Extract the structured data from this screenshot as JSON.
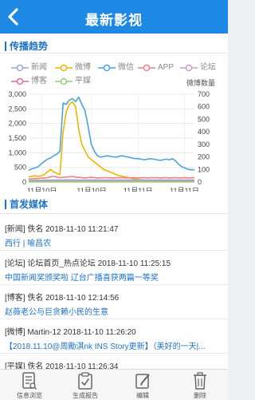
{
  "header": {
    "title": "最新影视"
  },
  "trend": {
    "title": "传播趋势",
    "legend": [
      {
        "label": "新闻",
        "color": "#9aa6d6"
      },
      {
        "label": "微博",
        "color": "#f0b400"
      },
      {
        "label": "微信",
        "color": "#4aa3df"
      },
      {
        "label": "APP",
        "color": "#f08080"
      },
      {
        "label": "论坛",
        "color": "#c8a0c8"
      },
      {
        "label": "博客",
        "color": "#e06d9a"
      },
      {
        "label": "平媒",
        "color": "#8fd16f"
      }
    ],
    "right_axis_label": "微博数量"
  },
  "chart_data": {
    "type": "line",
    "x_tick_labels": [
      "11月10日",
      "11月10日",
      "11月11日",
      "11月11日"
    ],
    "left_axis": {
      "range": [
        0,
        3000
      ],
      "ticks": [
        "0",
        "500",
        "1,000",
        "1,500",
        "2,000",
        "2,500",
        "3,000"
      ]
    },
    "right_axis": {
      "label": "微博数量",
      "range": [
        0,
        700
      ],
      "ticks": [
        "0",
        "100",
        "200",
        "300",
        "400",
        "500",
        "600",
        "700"
      ]
    },
    "series": [
      {
        "name": "微信",
        "axis": "left",
        "color": "#4aa3df",
        "values": [
          400,
          450,
          480,
          520,
          620,
          700,
          780,
          820,
          900,
          950,
          1050,
          2700,
          2650,
          2800,
          2850,
          2750,
          2900,
          2650,
          2450,
          1900,
          1300,
          1050,
          900,
          850,
          870,
          900,
          880,
          860,
          850,
          880,
          900,
          870,
          850,
          820,
          800,
          800,
          780,
          760,
          780,
          800,
          780,
          760,
          740,
          760,
          780,
          760,
          800,
          720,
          600,
          520,
          480,
          430,
          420,
          420
        ]
      },
      {
        "name": "微博",
        "axis": "right",
        "color": "#f0b400",
        "values": [
          40,
          45,
          50,
          45,
          50,
          60,
          80,
          100,
          80,
          70,
          60,
          400,
          560,
          620,
          640,
          600,
          420,
          300,
          250,
          200,
          180,
          160,
          140,
          120,
          100,
          90,
          80,
          70,
          60,
          50,
          45,
          40,
          35,
          30,
          25,
          20,
          18,
          15,
          15,
          14,
          13,
          12,
          12,
          12,
          12,
          12,
          12,
          12,
          12,
          12,
          12,
          12,
          12,
          12
        ]
      },
      {
        "name": "APP",
        "axis": "left",
        "color": "#f08080",
        "values": [
          100,
          110,
          120,
          120,
          130,
          140,
          150,
          180,
          190,
          170,
          150,
          160,
          170,
          180,
          190,
          170,
          160,
          150,
          140,
          150,
          160,
          150,
          140,
          145,
          150,
          150,
          145,
          140,
          150,
          145,
          150,
          140,
          150,
          145,
          150,
          140,
          145,
          150,
          140,
          150,
          145,
          150,
          140,
          145,
          150,
          140,
          145,
          150,
          140,
          145,
          150,
          140,
          145,
          150
        ]
      },
      {
        "name": "新闻",
        "axis": "left",
        "color": "#9aa6d6",
        "values": [
          50,
          55,
          60,
          60,
          60,
          65,
          65,
          70,
          70,
          70,
          70,
          70,
          75,
          75,
          75,
          70,
          70,
          70,
          70,
          70,
          70,
          70,
          70,
          70,
          70,
          70,
          70,
          70,
          70,
          70,
          70,
          70,
          70,
          70,
          70,
          70,
          70,
          70,
          70,
          70,
          70,
          70,
          70,
          70,
          70,
          70,
          70,
          70,
          70,
          70,
          70,
          70,
          70,
          70
        ]
      },
      {
        "name": "论坛",
        "axis": "left",
        "color": "#c8a0c8",
        "values": [
          20,
          22,
          25,
          25,
          25,
          30,
          30,
          30,
          30,
          30,
          30,
          30,
          30,
          30,
          30,
          30,
          30,
          30,
          30,
          30,
          30,
          30,
          30,
          30,
          30,
          30,
          30,
          30,
          30,
          30,
          30,
          30,
          30,
          30,
          30,
          30,
          30,
          30,
          30,
          30,
          30,
          30,
          30,
          30,
          30,
          30,
          30,
          30,
          30,
          30,
          30,
          30,
          30,
          30
        ]
      },
      {
        "name": "博客",
        "axis": "left",
        "color": "#e06d9a",
        "values": [
          10,
          10,
          12,
          12,
          12,
          12,
          12,
          12,
          12,
          12,
          12,
          12,
          12,
          12,
          12,
          12,
          12,
          12,
          12,
          12,
          12,
          12,
          12,
          12,
          12,
          12,
          12,
          12,
          12,
          12,
          12,
          12,
          12,
          12,
          12,
          12,
          12,
          12,
          12,
          12,
          12,
          12,
          12,
          12,
          12,
          12,
          12,
          12,
          12,
          12,
          12,
          12,
          12,
          12
        ]
      },
      {
        "name": "平媒",
        "axis": "left",
        "color": "#8fd16f",
        "values": [
          5,
          5,
          5,
          5,
          5,
          5,
          5,
          5,
          5,
          5,
          5,
          5,
          5,
          5,
          5,
          5,
          5,
          5,
          5,
          5,
          5,
          5,
          5,
          5,
          5,
          5,
          5,
          5,
          5,
          5,
          5,
          5,
          5,
          5,
          5,
          5,
          5,
          5,
          5,
          5,
          5,
          5,
          5,
          5,
          5,
          5,
          5,
          5,
          5,
          5,
          5,
          5,
          5,
          5
        ]
      }
    ]
  },
  "media": {
    "title": "首发媒体",
    "items": [
      {
        "line1": "[新闻]  佚名  2018-11-10 11:21:47",
        "line2": "西行 | 喻昌农"
      },
      {
        "line1": "[论坛]  论坛首页_热点论坛  2018-11-10 11:25:15",
        "line2": "中国新闻奖颁奖啦 辽台广播喜获两篇一等奖"
      },
      {
        "line1": "[博客]  佚名  2018-11-10 12:14:56",
        "line2": "赵薇老公与巨贪赖小民的生意"
      },
      {
        "line1": "[微博]  Martin-12  2018-11-10 11:26:20",
        "line2": "【2018.11.10@周勵淇nk INS Story更新】（美好的一天|..."
      },
      {
        "line1": "[平媒]  佚名  2018-11-10 11:26:34",
        "line2": ""
      }
    ]
  },
  "tabs": [
    {
      "label": "信息浏览",
      "icon": "document-list-icon"
    },
    {
      "label": "生成报告",
      "icon": "clipboard-check-icon"
    },
    {
      "label": "编辑",
      "icon": "edit-icon"
    },
    {
      "label": "删除",
      "icon": "trash-icon"
    }
  ]
}
